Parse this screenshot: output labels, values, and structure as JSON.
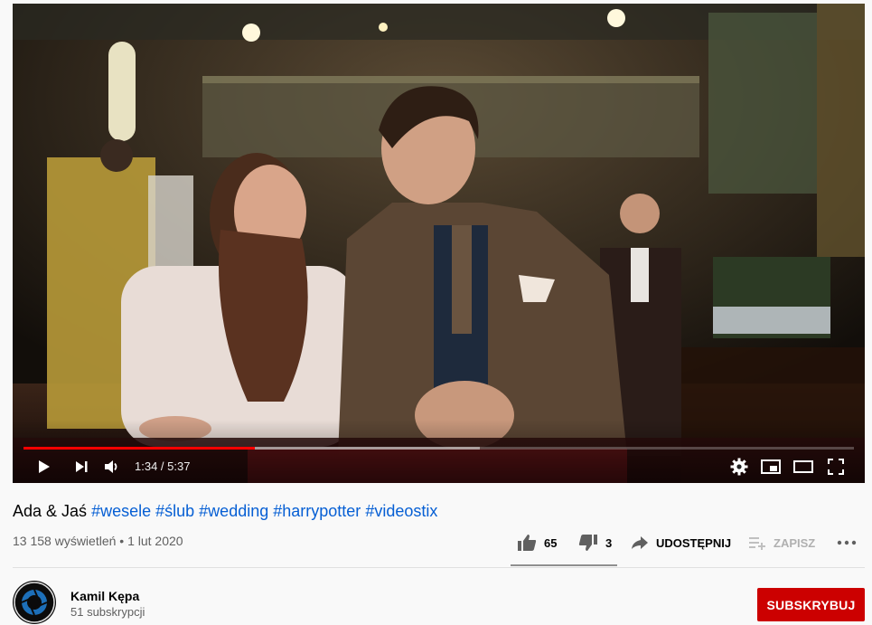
{
  "player": {
    "current_time": "1:34",
    "duration": "5:37",
    "time_display": "1:34 / 5:37",
    "played_fraction": 0.279,
    "buffered_fraction": 0.55
  },
  "video": {
    "title_prefix": "Ada & Jaś",
    "hashtags": [
      "#wesele",
      "#ślub",
      "#wedding",
      "#harrypotter",
      "#videostix"
    ],
    "views": "13 158 wyświetleń",
    "date": "1 lut 2020",
    "meta": "13 158 wyświetleń • 1 lut 2020"
  },
  "actions": {
    "likes": "65",
    "dislikes": "3",
    "share_label": "UDOSTĘPNIJ",
    "save_label": "ZAPISZ",
    "more_icon": "more-horizontal-icon"
  },
  "channel": {
    "name": "Kamil Kępa",
    "subscribers": "51 subskrypcji",
    "subscribe_label": "SUBSKRYBUJ"
  },
  "colors": {
    "accent_red": "#cc0000",
    "progress_red": "#ff0000",
    "hashtag_blue": "#065fd4",
    "meta_gray": "#606060"
  }
}
